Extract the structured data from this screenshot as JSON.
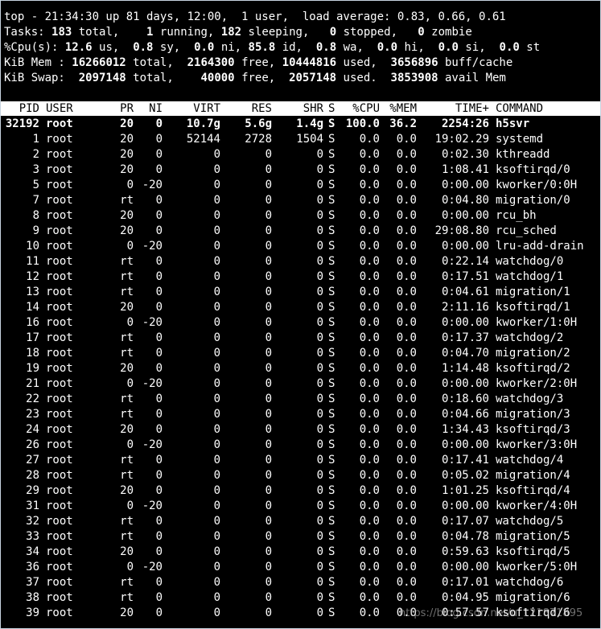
{
  "summary": {
    "line1": "top - 21:34:30 up 81 days, 12:00,  1 user,  load average: 0.83, 0.66, 0.61",
    "tasks": {
      "label": "Tasks:",
      "total": "183",
      "total_t": "total,",
      "running": "1",
      "running_t": "running,",
      "sleeping": "182",
      "sleeping_t": "sleeping,",
      "stopped": "0",
      "stopped_t": "stopped,",
      "zombie": "0",
      "zombie_t": "zombie"
    },
    "cpu": {
      "label": "%Cpu(s):",
      "us": "12.6",
      "us_t": "us,",
      "sy": "0.8",
      "sy_t": "sy,",
      "ni": "0.0",
      "ni_t": "ni,",
      "id": "85.8",
      "id_t": "id,",
      "wa": "0.8",
      "wa_t": "wa,",
      "hi": "0.0",
      "hi_t": "hi,",
      "si": "0.0",
      "si_t": "si,",
      "st": "0.0",
      "st_t": "st"
    },
    "mem": {
      "label": "KiB Mem :",
      "total": "16266012",
      "total_t": "total,",
      "free": "2164300",
      "free_t": "free,",
      "used": "10444816",
      "used_t": "used,",
      "buff": "3656896",
      "buff_t": "buff/cache"
    },
    "swap": {
      "label": "KiB Swap:",
      "total": "2097148",
      "total_t": "total,",
      "free": "40000",
      "free_t": "free,",
      "used": "2057148",
      "used_t": "used.",
      "avail": "3853908",
      "avail_t": "avail Mem"
    }
  },
  "columns": [
    "PID",
    "USER",
    "PR",
    "NI",
    "VIRT",
    "RES",
    "SHR",
    "S",
    "%CPU",
    "%MEM",
    "TIME+",
    "COMMAND"
  ],
  "processes": [
    [
      "32192",
      "root",
      "20",
      "0",
      "10.7g",
      "5.6g",
      "1.4g",
      "S",
      "100.0",
      "36.2",
      "2254:26",
      "h5svr"
    ],
    [
      "1",
      "root",
      "20",
      "0",
      "52144",
      "2728",
      "1504",
      "S",
      "0.0",
      "0.0",
      "19:02.29",
      "systemd"
    ],
    [
      "2",
      "root",
      "20",
      "0",
      "0",
      "0",
      "0",
      "S",
      "0.0",
      "0.0",
      "0:02.30",
      "kthreadd"
    ],
    [
      "3",
      "root",
      "20",
      "0",
      "0",
      "0",
      "0",
      "S",
      "0.0",
      "0.0",
      "1:08.41",
      "ksoftirqd/0"
    ],
    [
      "5",
      "root",
      "0",
      "-20",
      "0",
      "0",
      "0",
      "S",
      "0.0",
      "0.0",
      "0:00.00",
      "kworker/0:0H"
    ],
    [
      "7",
      "root",
      "rt",
      "0",
      "0",
      "0",
      "0",
      "S",
      "0.0",
      "0.0",
      "0:04.80",
      "migration/0"
    ],
    [
      "8",
      "root",
      "20",
      "0",
      "0",
      "0",
      "0",
      "S",
      "0.0",
      "0.0",
      "0:00.00",
      "rcu_bh"
    ],
    [
      "9",
      "root",
      "20",
      "0",
      "0",
      "0",
      "0",
      "S",
      "0.0",
      "0.0",
      "29:08.80",
      "rcu_sched"
    ],
    [
      "10",
      "root",
      "0",
      "-20",
      "0",
      "0",
      "0",
      "S",
      "0.0",
      "0.0",
      "0:00.00",
      "lru-add-drain"
    ],
    [
      "11",
      "root",
      "rt",
      "0",
      "0",
      "0",
      "0",
      "S",
      "0.0",
      "0.0",
      "0:22.14",
      "watchdog/0"
    ],
    [
      "12",
      "root",
      "rt",
      "0",
      "0",
      "0",
      "0",
      "S",
      "0.0",
      "0.0",
      "0:17.51",
      "watchdog/1"
    ],
    [
      "13",
      "root",
      "rt",
      "0",
      "0",
      "0",
      "0",
      "S",
      "0.0",
      "0.0",
      "0:04.61",
      "migration/1"
    ],
    [
      "14",
      "root",
      "20",
      "0",
      "0",
      "0",
      "0",
      "S",
      "0.0",
      "0.0",
      "2:11.16",
      "ksoftirqd/1"
    ],
    [
      "16",
      "root",
      "0",
      "-20",
      "0",
      "0",
      "0",
      "S",
      "0.0",
      "0.0",
      "0:00.00",
      "kworker/1:0H"
    ],
    [
      "17",
      "root",
      "rt",
      "0",
      "0",
      "0",
      "0",
      "S",
      "0.0",
      "0.0",
      "0:17.37",
      "watchdog/2"
    ],
    [
      "18",
      "root",
      "rt",
      "0",
      "0",
      "0",
      "0",
      "S",
      "0.0",
      "0.0",
      "0:04.70",
      "migration/2"
    ],
    [
      "19",
      "root",
      "20",
      "0",
      "0",
      "0",
      "0",
      "S",
      "0.0",
      "0.0",
      "1:14.48",
      "ksoftirqd/2"
    ],
    [
      "21",
      "root",
      "0",
      "-20",
      "0",
      "0",
      "0",
      "S",
      "0.0",
      "0.0",
      "0:00.00",
      "kworker/2:0H"
    ],
    [
      "22",
      "root",
      "rt",
      "0",
      "0",
      "0",
      "0",
      "S",
      "0.0",
      "0.0",
      "0:18.60",
      "watchdog/3"
    ],
    [
      "23",
      "root",
      "rt",
      "0",
      "0",
      "0",
      "0",
      "S",
      "0.0",
      "0.0",
      "0:04.66",
      "migration/3"
    ],
    [
      "24",
      "root",
      "20",
      "0",
      "0",
      "0",
      "0",
      "S",
      "0.0",
      "0.0",
      "1:34.43",
      "ksoftirqd/3"
    ],
    [
      "26",
      "root",
      "0",
      "-20",
      "0",
      "0",
      "0",
      "S",
      "0.0",
      "0.0",
      "0:00.00",
      "kworker/3:0H"
    ],
    [
      "27",
      "root",
      "rt",
      "0",
      "0",
      "0",
      "0",
      "S",
      "0.0",
      "0.0",
      "0:17.41",
      "watchdog/4"
    ],
    [
      "28",
      "root",
      "rt",
      "0",
      "0",
      "0",
      "0",
      "S",
      "0.0",
      "0.0",
      "0:05.02",
      "migration/4"
    ],
    [
      "29",
      "root",
      "20",
      "0",
      "0",
      "0",
      "0",
      "S",
      "0.0",
      "0.0",
      "1:01.25",
      "ksoftirqd/4"
    ],
    [
      "31",
      "root",
      "0",
      "-20",
      "0",
      "0",
      "0",
      "S",
      "0.0",
      "0.0",
      "0:00.00",
      "kworker/4:0H"
    ],
    [
      "32",
      "root",
      "rt",
      "0",
      "0",
      "0",
      "0",
      "S",
      "0.0",
      "0.0",
      "0:17.07",
      "watchdog/5"
    ],
    [
      "33",
      "root",
      "rt",
      "0",
      "0",
      "0",
      "0",
      "S",
      "0.0",
      "0.0",
      "0:04.78",
      "migration/5"
    ],
    [
      "34",
      "root",
      "20",
      "0",
      "0",
      "0",
      "0",
      "S",
      "0.0",
      "0.0",
      "0:59.63",
      "ksoftirqd/5"
    ],
    [
      "36",
      "root",
      "0",
      "-20",
      "0",
      "0",
      "0",
      "S",
      "0.0",
      "0.0",
      "0:00.00",
      "kworker/5:0H"
    ],
    [
      "37",
      "root",
      "rt",
      "0",
      "0",
      "0",
      "0",
      "S",
      "0.0",
      "0.0",
      "0:17.01",
      "watchdog/6"
    ],
    [
      "38",
      "root",
      "rt",
      "0",
      "0",
      "0",
      "0",
      "S",
      "0.0",
      "0.0",
      "0:04.95",
      "migration/6"
    ],
    [
      "39",
      "root",
      "20",
      "0",
      "0",
      "0",
      "0",
      "S",
      "0.0",
      "0.0",
      "0:57.57",
      "ksoftirqd/6"
    ]
  ],
  "watermark": "https://blog.csdn.net/u_121871895",
  "colors": {
    "terminal_bg": "#000000",
    "text": "#ffffff",
    "header_bg": "#ffffff",
    "header_text": "#000000"
  }
}
